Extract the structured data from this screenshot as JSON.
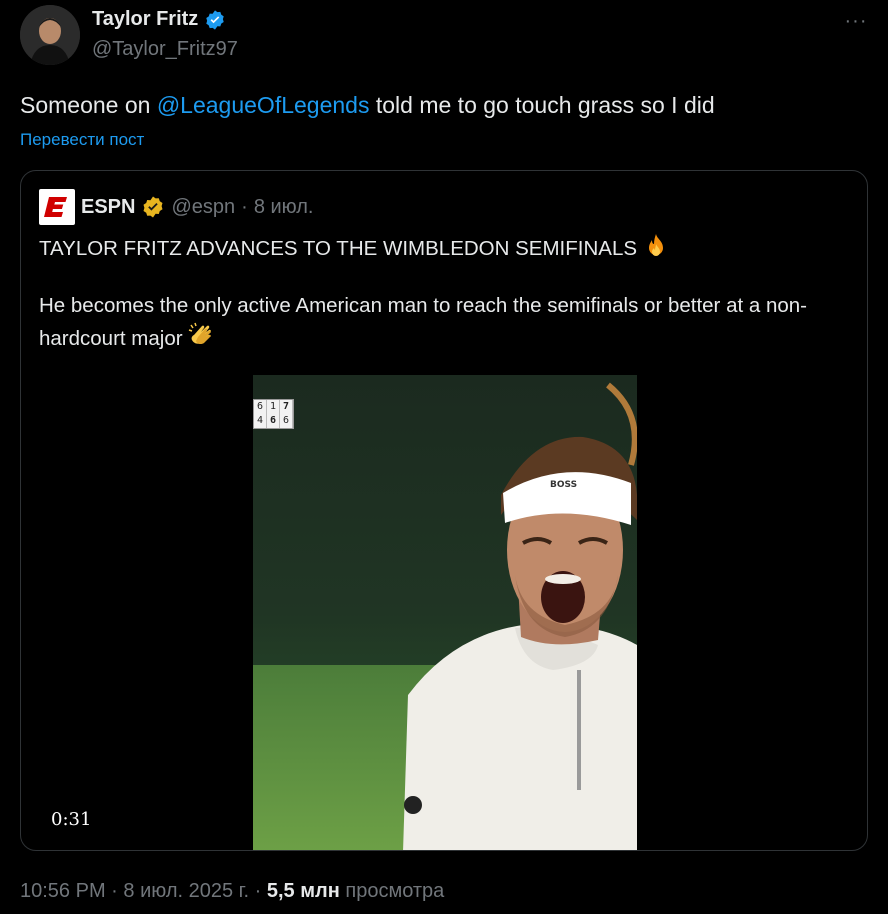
{
  "author": {
    "name": "Taylor Fritz",
    "handle": "@Taylor_Fritz97"
  },
  "menu": {
    "more_icon": "···"
  },
  "tweet": {
    "text_before": "Someone on ",
    "mention": "@LeagueOfLegends",
    "text_after": " told me to go touch grass so I did",
    "translate_label": "Перевести пост"
  },
  "quote": {
    "name": "ESPN",
    "handle": "@espn",
    "separator": "·",
    "date": "8 июл.",
    "headline": "TAYLOR FRITZ ADVANCES TO THE WIMBLEDON SEMIFINALS",
    "body": "He becomes the only active American man to reach the semifinals or better at a non-hardcourt major",
    "video": {
      "duration": "0:31",
      "scoreboard": [
        [
          "6",
          "1",
          "7"
        ],
        [
          "4",
          "6",
          "6"
        ]
      ],
      "headband_text": "BOSS"
    }
  },
  "meta": {
    "time": "10:56 PM",
    "separator": "·",
    "date": "8 июл. 2025 г.",
    "views_count": "5,5 млн",
    "views_label": "просмотра"
  },
  "colors": {
    "background": "#000000",
    "text": "#e7e9ea",
    "muted": "#71767b",
    "link": "#1d9bf0",
    "border": "#2f3336",
    "espn_red": "#d00000"
  }
}
